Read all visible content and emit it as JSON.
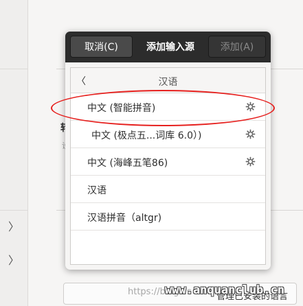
{
  "dialog": {
    "cancel_label": "取消(C)",
    "title": "添加输入源",
    "add_label": "添加(A)"
  },
  "language": {
    "back_icon": "chevron-left-icon",
    "name": "汉语"
  },
  "input_sources": [
    {
      "label": "中文 (智能拼音)",
      "has_settings": true
    },
    {
      "label": "中文 (极点五...词库 6.0）)",
      "has_settings": true
    },
    {
      "label": "中文 (海峰五笔86)",
      "has_settings": true
    },
    {
      "label": "汉语",
      "has_settings": false
    },
    {
      "label": "汉语拼音（altgr)",
      "has_settings": false
    }
  ],
  "background": {
    "left_panel_chevrons": [
      "〉",
      "〉"
    ],
    "bold_fragment": "转",
    "small_fragment": "设",
    "bottom_button_label": "管理已安装的语言"
  },
  "watermark": {
    "text": "https://blog.cs",
    "bold_text": "www.anquanclub.cn"
  },
  "colors": {
    "header_bg": "#2c2c2c",
    "annotation": "#e6201e"
  }
}
